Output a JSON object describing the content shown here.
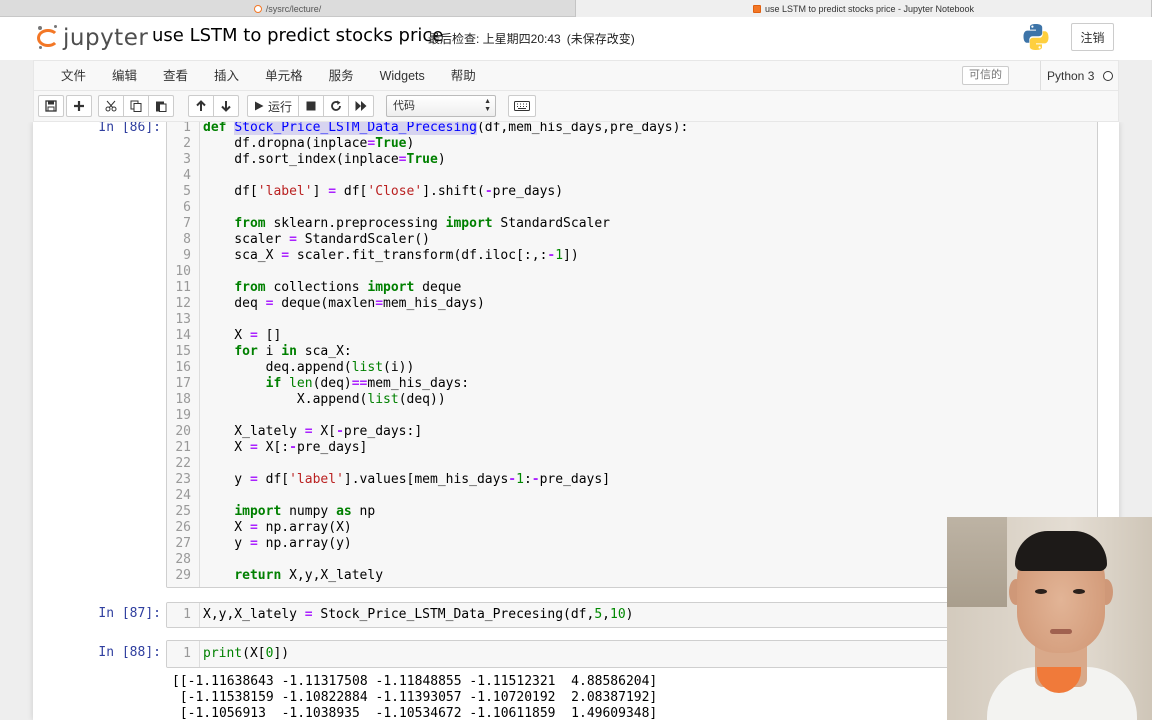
{
  "browser": {
    "tabs": [
      {
        "title": "/sysrc/lecture/"
      },
      {
        "title": "use LSTM to predict stocks price - Jupyter Notebook"
      }
    ]
  },
  "header": {
    "logo_text": "jupyter",
    "notebook_title": "use LSTM to predict stocks price",
    "checkpoint": "最后检查: 上星期四20:43",
    "unsaved": "(未保存改变)",
    "logout": "注销"
  },
  "menubar": {
    "items": [
      "文件",
      "编辑",
      "查看",
      "插入",
      "单元格",
      "服务",
      "Widgets",
      "帮助"
    ],
    "trusted": "可信的",
    "kernel": "Python 3"
  },
  "toolbar": {
    "run_label": "运行",
    "cell_type": "代码"
  },
  "cells": [
    {
      "prompt": "In [86]:",
      "lines": [
        "def Stock_Price_LSTM_Data_Precesing(df,mem_his_days,pre_days):",
        "    df.dropna(inplace=True)",
        "    df.sort_index(inplace=True)",
        "",
        "    df['label'] = df['Close'].shift(-pre_days)",
        "",
        "    from sklearn.preprocessing import StandardScaler",
        "    scaler = StandardScaler()",
        "    sca_X = scaler.fit_transform(df.iloc[:,:-1])",
        "",
        "    from collections import deque",
        "    deq = deque(maxlen=mem_his_days)",
        "",
        "    X = []",
        "    for i in sca_X:",
        "        deq.append(list(i))",
        "        if len(deq)==mem_his_days:",
        "            X.append(list(deq))",
        "",
        "    X_lately = X[-pre_days:]",
        "    X = X[:-pre_days]",
        "",
        "    y = df['label'].values[mem_his_days-1:-pre_days]",
        "",
        "    import numpy as np",
        "    X = np.array(X)",
        "    y = np.array(y)",
        "",
        "    return X,y,X_lately"
      ]
    },
    {
      "prompt": "In [87]:",
      "lines": [
        "X,y,X_lately = Stock_Price_LSTM_Data_Precesing(df,5,10)"
      ]
    },
    {
      "prompt": "In [88]:",
      "lines": [
        "print(X[0])"
      ],
      "output": [
        "[[-1.11638643 -1.11317508 -1.11848855 -1.11512321  4.88586204]",
        " [-1.11538159 -1.10822884 -1.11393057 -1.10720192  2.08387192]",
        " [-1.1056913  -1.1038935  -1.10534672 -1.10611859  1.49609348]"
      ]
    }
  ],
  "colors": {
    "prompt": "#303f9f",
    "keyword": "#008000",
    "string": "#ba2121",
    "operator": "#aa22ff",
    "accent": "#f37726"
  }
}
